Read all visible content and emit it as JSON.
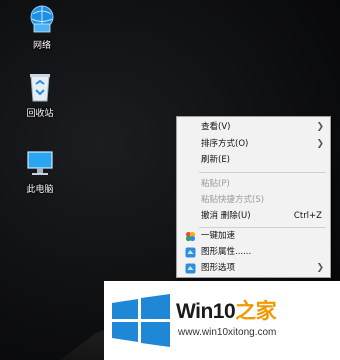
{
  "desktop": {
    "icons": [
      {
        "label": "网络",
        "icon": "network-icon"
      },
      {
        "label": "回收站",
        "icon": "recycle-bin-icon"
      },
      {
        "label": "此电脑",
        "icon": "this-pc-icon"
      }
    ]
  },
  "context_menu": {
    "items": [
      {
        "label": "查看(V)",
        "has_submenu": true,
        "enabled": true
      },
      {
        "label": "排序方式(O)",
        "has_submenu": true,
        "enabled": true
      },
      {
        "label": "刷新(E)",
        "enabled": true
      },
      {
        "label": "粘贴(P)",
        "enabled": false
      },
      {
        "label": "粘贴快捷方式(S)",
        "enabled": false
      },
      {
        "label": "撤消 删除(U)",
        "shortcut": "Ctrl+Z",
        "enabled": true
      },
      {
        "label": "一键加速",
        "icon": "speed-up-icon",
        "enabled": true
      },
      {
        "label": "图形属性......",
        "icon": "graphics-properties-icon",
        "enabled": true
      },
      {
        "label": "图形选项",
        "icon": "graphics-options-icon",
        "has_submenu": true,
        "enabled": true
      }
    ]
  },
  "watermark": {
    "brand_prefix": "Win10",
    "brand_suffix": "之家",
    "url": "www.win10xitong.com",
    "colors": {
      "logo_blue": "#1e88d6",
      "accent_orange": "#f29800"
    }
  }
}
